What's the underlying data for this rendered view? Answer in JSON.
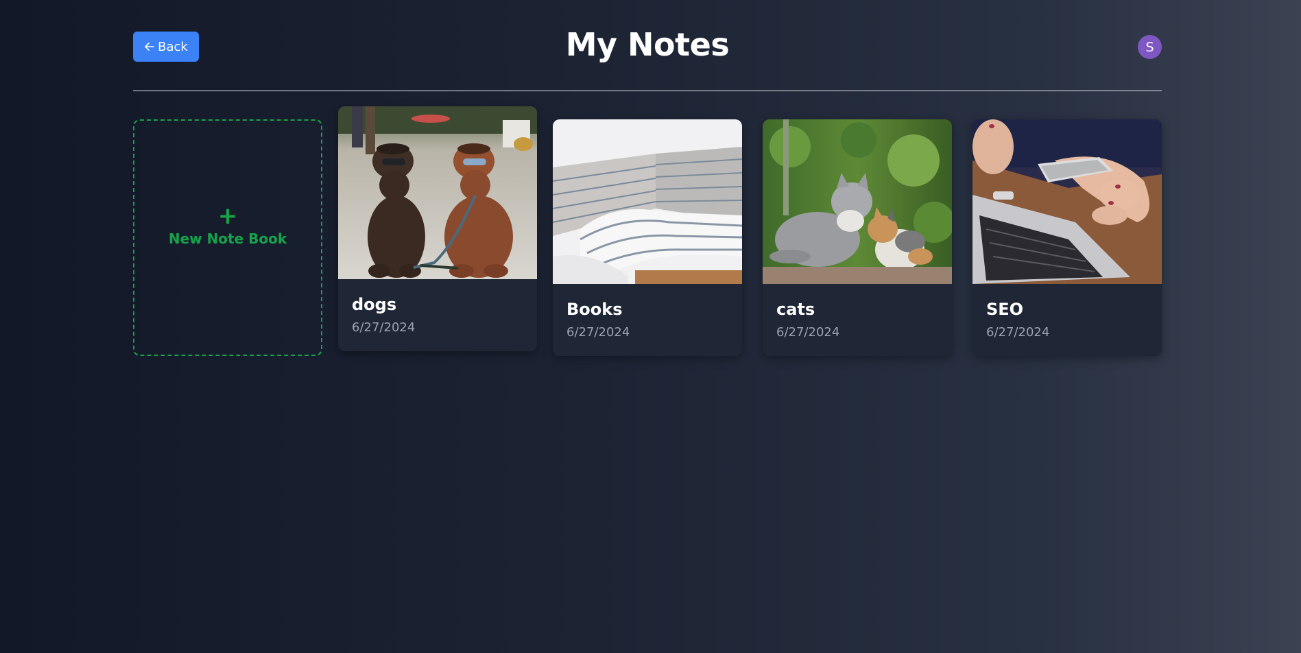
{
  "header": {
    "back_label": "Back",
    "title": "My Notes",
    "avatar_initial": "S"
  },
  "new_notebook": {
    "label": "New Note Book",
    "icon": "plus-icon"
  },
  "notebooks": [
    {
      "title": "dogs",
      "date": "6/27/2024",
      "image": "two-poodles-photo"
    },
    {
      "title": "Books",
      "date": "6/27/2024",
      "image": "library-shelves-photo"
    },
    {
      "title": "cats",
      "date": "6/27/2024",
      "image": "two-cats-photo"
    },
    {
      "title": "SEO",
      "date": "6/27/2024",
      "image": "phone-laptop-photo"
    }
  ],
  "colors": {
    "back_button": "#3b82f6",
    "avatar": "#7e57c2",
    "new_notebook_accent": "#16a34a",
    "card_background": "#1f2736",
    "date_text": "#9ca3af"
  }
}
